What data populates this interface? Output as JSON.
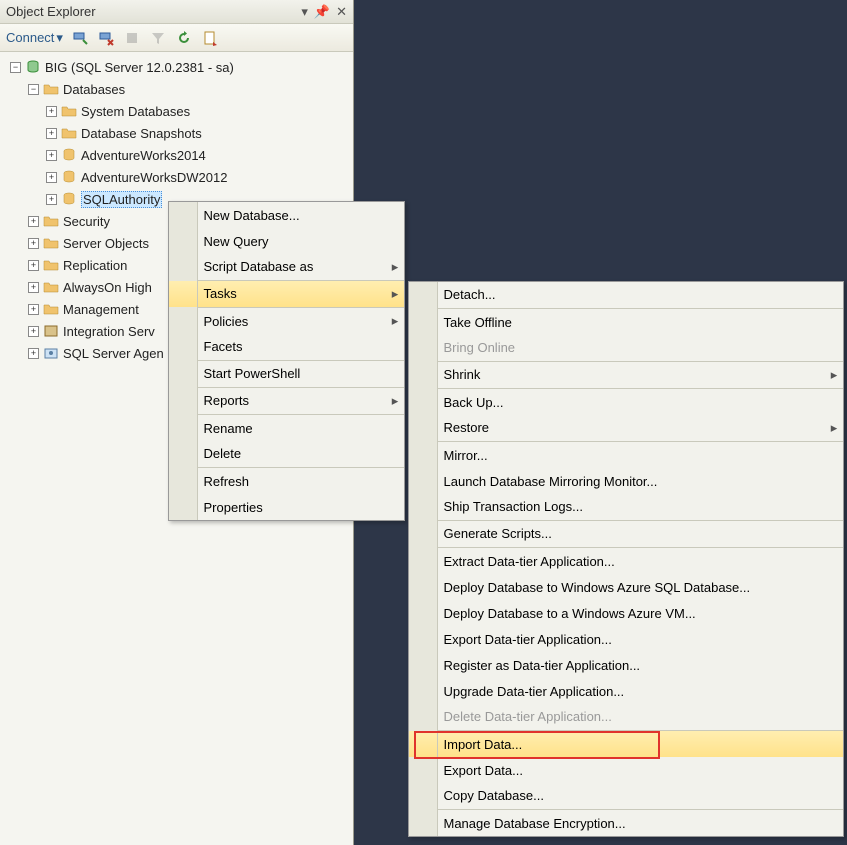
{
  "panel": {
    "title": "Object Explorer"
  },
  "toolbar": {
    "connect": "Connect"
  },
  "tree": {
    "root": "BIG (SQL Server 12.0.2381 - sa)",
    "databases": "Databases",
    "sysdb": "System Databases",
    "snap": "Database Snapshots",
    "aw14": "AdventureWorks2014",
    "awdw": "AdventureWorksDW2012",
    "sqla": "SQLAuthority",
    "sec": "Security",
    "sobj": "Server Objects",
    "repl": "Replication",
    "aoha": "AlwaysOn High",
    "mgmt": "Management",
    "isvc": "Integration Serv",
    "agen": "SQL Server Agen"
  },
  "ctx1": {
    "newdb": "New Database...",
    "newq": "New Query",
    "sdb": "Script Database as",
    "tasks": "Tasks",
    "pol": "Policies",
    "fac": "Facets",
    "ps": "Start PowerShell",
    "rep": "Reports",
    "ren": "Rename",
    "del": "Delete",
    "refr": "Refresh",
    "prop": "Properties"
  },
  "ctx2": {
    "det": "Detach...",
    "toff": "Take Offline",
    "bon": "Bring Online",
    "shr": "Shrink",
    "bak": "Back Up...",
    "res": "Restore",
    "mir": "Mirror...",
    "ldmm": "Launch Database Mirroring Monitor...",
    "stl": "Ship Transaction Logs...",
    "gs": "Generate Scripts...",
    "edta": "Extract Data-tier Application...",
    "ddaz": "Deploy Database to Windows Azure SQL Database...",
    "ddvm": "Deploy Database to a Windows Azure VM...",
    "exdta": "Export Data-tier Application...",
    "rdta": "Register as Data-tier Application...",
    "udta": "Upgrade Data-tier Application...",
    "ddta": "Delete Data-tier Application...",
    "imp": "Import Data...",
    "expd": "Export Data...",
    "cpy": "Copy Database...",
    "mde": "Manage Database Encryption..."
  }
}
